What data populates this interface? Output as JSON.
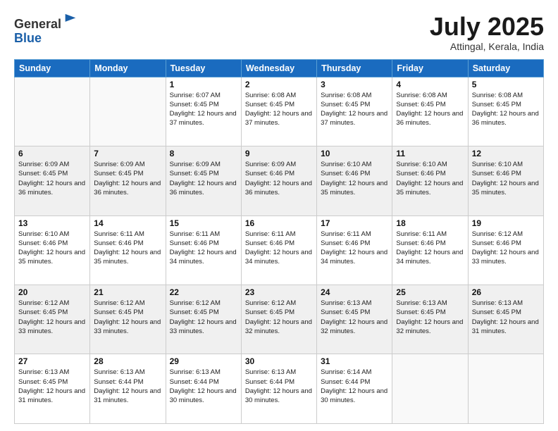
{
  "header": {
    "logo_line1": "General",
    "logo_line2": "Blue",
    "month_year": "July 2025",
    "location": "Attingal, Kerala, India"
  },
  "weekdays": [
    "Sunday",
    "Monday",
    "Tuesday",
    "Wednesday",
    "Thursday",
    "Friday",
    "Saturday"
  ],
  "weeks": [
    [
      {
        "day": "",
        "info": ""
      },
      {
        "day": "",
        "info": ""
      },
      {
        "day": "1",
        "info": "Sunrise: 6:07 AM\nSunset: 6:45 PM\nDaylight: 12 hours and 37 minutes."
      },
      {
        "day": "2",
        "info": "Sunrise: 6:08 AM\nSunset: 6:45 PM\nDaylight: 12 hours and 37 minutes."
      },
      {
        "day": "3",
        "info": "Sunrise: 6:08 AM\nSunset: 6:45 PM\nDaylight: 12 hours and 37 minutes."
      },
      {
        "day": "4",
        "info": "Sunrise: 6:08 AM\nSunset: 6:45 PM\nDaylight: 12 hours and 36 minutes."
      },
      {
        "day": "5",
        "info": "Sunrise: 6:08 AM\nSunset: 6:45 PM\nDaylight: 12 hours and 36 minutes."
      }
    ],
    [
      {
        "day": "6",
        "info": "Sunrise: 6:09 AM\nSunset: 6:45 PM\nDaylight: 12 hours and 36 minutes."
      },
      {
        "day": "7",
        "info": "Sunrise: 6:09 AM\nSunset: 6:45 PM\nDaylight: 12 hours and 36 minutes."
      },
      {
        "day": "8",
        "info": "Sunrise: 6:09 AM\nSunset: 6:45 PM\nDaylight: 12 hours and 36 minutes."
      },
      {
        "day": "9",
        "info": "Sunrise: 6:09 AM\nSunset: 6:46 PM\nDaylight: 12 hours and 36 minutes."
      },
      {
        "day": "10",
        "info": "Sunrise: 6:10 AM\nSunset: 6:46 PM\nDaylight: 12 hours and 35 minutes."
      },
      {
        "day": "11",
        "info": "Sunrise: 6:10 AM\nSunset: 6:46 PM\nDaylight: 12 hours and 35 minutes."
      },
      {
        "day": "12",
        "info": "Sunrise: 6:10 AM\nSunset: 6:46 PM\nDaylight: 12 hours and 35 minutes."
      }
    ],
    [
      {
        "day": "13",
        "info": "Sunrise: 6:10 AM\nSunset: 6:46 PM\nDaylight: 12 hours and 35 minutes."
      },
      {
        "day": "14",
        "info": "Sunrise: 6:11 AM\nSunset: 6:46 PM\nDaylight: 12 hours and 35 minutes."
      },
      {
        "day": "15",
        "info": "Sunrise: 6:11 AM\nSunset: 6:46 PM\nDaylight: 12 hours and 34 minutes."
      },
      {
        "day": "16",
        "info": "Sunrise: 6:11 AM\nSunset: 6:46 PM\nDaylight: 12 hours and 34 minutes."
      },
      {
        "day": "17",
        "info": "Sunrise: 6:11 AM\nSunset: 6:46 PM\nDaylight: 12 hours and 34 minutes."
      },
      {
        "day": "18",
        "info": "Sunrise: 6:11 AM\nSunset: 6:46 PM\nDaylight: 12 hours and 34 minutes."
      },
      {
        "day": "19",
        "info": "Sunrise: 6:12 AM\nSunset: 6:46 PM\nDaylight: 12 hours and 33 minutes."
      }
    ],
    [
      {
        "day": "20",
        "info": "Sunrise: 6:12 AM\nSunset: 6:45 PM\nDaylight: 12 hours and 33 minutes."
      },
      {
        "day": "21",
        "info": "Sunrise: 6:12 AM\nSunset: 6:45 PM\nDaylight: 12 hours and 33 minutes."
      },
      {
        "day": "22",
        "info": "Sunrise: 6:12 AM\nSunset: 6:45 PM\nDaylight: 12 hours and 33 minutes."
      },
      {
        "day": "23",
        "info": "Sunrise: 6:12 AM\nSunset: 6:45 PM\nDaylight: 12 hours and 32 minutes."
      },
      {
        "day": "24",
        "info": "Sunrise: 6:13 AM\nSunset: 6:45 PM\nDaylight: 12 hours and 32 minutes."
      },
      {
        "day": "25",
        "info": "Sunrise: 6:13 AM\nSunset: 6:45 PM\nDaylight: 12 hours and 32 minutes."
      },
      {
        "day": "26",
        "info": "Sunrise: 6:13 AM\nSunset: 6:45 PM\nDaylight: 12 hours and 31 minutes."
      }
    ],
    [
      {
        "day": "27",
        "info": "Sunrise: 6:13 AM\nSunset: 6:45 PM\nDaylight: 12 hours and 31 minutes."
      },
      {
        "day": "28",
        "info": "Sunrise: 6:13 AM\nSunset: 6:44 PM\nDaylight: 12 hours and 31 minutes."
      },
      {
        "day": "29",
        "info": "Sunrise: 6:13 AM\nSunset: 6:44 PM\nDaylight: 12 hours and 30 minutes."
      },
      {
        "day": "30",
        "info": "Sunrise: 6:13 AM\nSunset: 6:44 PM\nDaylight: 12 hours and 30 minutes."
      },
      {
        "day": "31",
        "info": "Sunrise: 6:14 AM\nSunset: 6:44 PM\nDaylight: 12 hours and 30 minutes."
      },
      {
        "day": "",
        "info": ""
      },
      {
        "day": "",
        "info": ""
      }
    ]
  ]
}
